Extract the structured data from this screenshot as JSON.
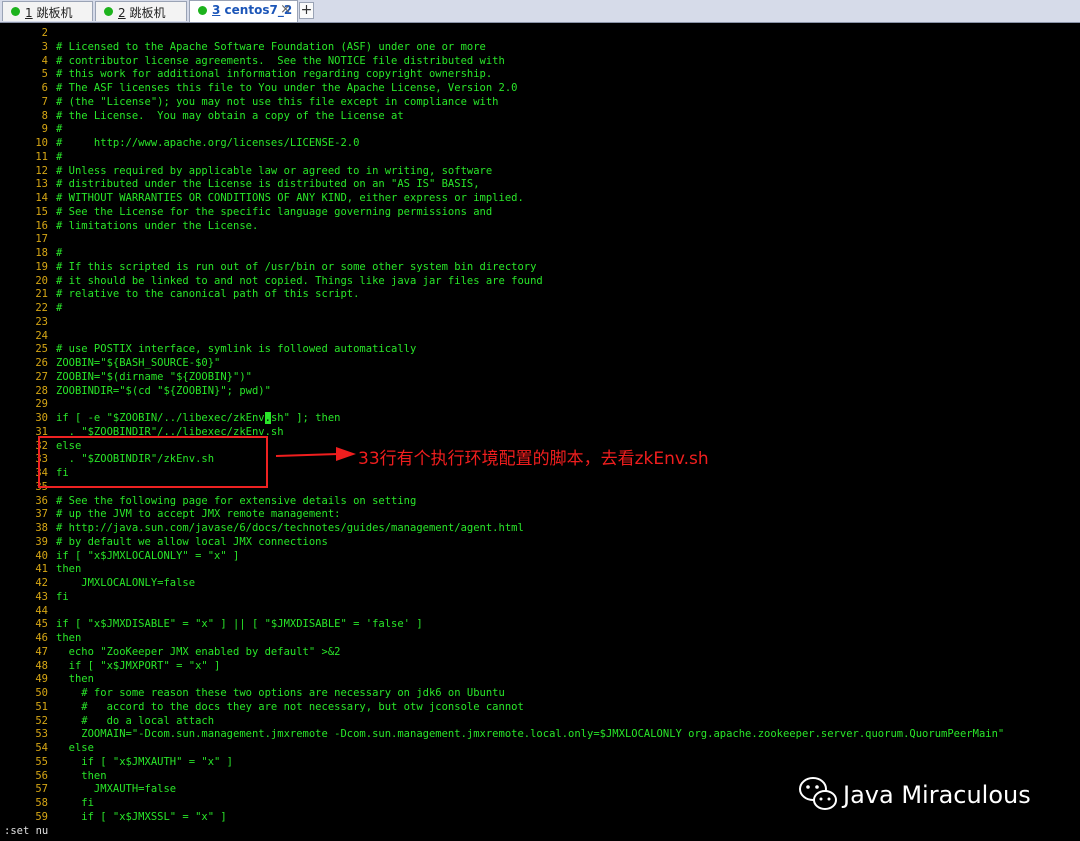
{
  "tabs": [
    {
      "number": "1",
      "label": "跳板机",
      "active": false
    },
    {
      "number": "2",
      "label": "跳板机",
      "active": false
    },
    {
      "number": "3",
      "label": "centos7_2",
      "active": true
    }
  ],
  "new_tab_label": "+",
  "close_glyph": "×",
  "colors": {
    "code": "#29e629",
    "line_number": "#d6a615",
    "annotation": "#f01e1e",
    "status_dot": "#1db31d"
  },
  "editor": {
    "lines": [
      {
        "n": "2",
        "text": ""
      },
      {
        "n": "3",
        "text": "# Licensed to the Apache Software Foundation (ASF) under one or more"
      },
      {
        "n": "4",
        "text": "# contributor license agreements.  See the NOTICE file distributed with"
      },
      {
        "n": "5",
        "text": "# this work for additional information regarding copyright ownership."
      },
      {
        "n": "6",
        "text": "# The ASF licenses this file to You under the Apache License, Version 2.0"
      },
      {
        "n": "7",
        "text": "# (the \"License\"); you may not use this file except in compliance with"
      },
      {
        "n": "8",
        "text": "# the License.  You may obtain a copy of the License at"
      },
      {
        "n": "9",
        "text": "#"
      },
      {
        "n": "10",
        "text": "#     http://www.apache.org/licenses/LICENSE-2.0"
      },
      {
        "n": "11",
        "text": "#"
      },
      {
        "n": "12",
        "text": "# Unless required by applicable law or agreed to in writing, software"
      },
      {
        "n": "13",
        "text": "# distributed under the License is distributed on an \"AS IS\" BASIS,"
      },
      {
        "n": "14",
        "text": "# WITHOUT WARRANTIES OR CONDITIONS OF ANY KIND, either express or implied."
      },
      {
        "n": "15",
        "text": "# See the License for the specific language governing permissions and"
      },
      {
        "n": "16",
        "text": "# limitations under the License."
      },
      {
        "n": "17",
        "text": ""
      },
      {
        "n": "18",
        "text": "#"
      },
      {
        "n": "19",
        "text": "# If this scripted is run out of /usr/bin or some other system bin directory"
      },
      {
        "n": "20",
        "text": "# it should be linked to and not copied. Things like java jar files are found"
      },
      {
        "n": "21",
        "text": "# relative to the canonical path of this script."
      },
      {
        "n": "22",
        "text": "#"
      },
      {
        "n": "23",
        "text": ""
      },
      {
        "n": "24",
        "text": ""
      },
      {
        "n": "25",
        "text": "# use POSTIX interface, symlink is followed automatically"
      },
      {
        "n": "26",
        "text": "ZOOBIN=\"${BASH_SOURCE-$0}\""
      },
      {
        "n": "27",
        "text": "ZOOBIN=\"$(dirname \"${ZOOBIN}\")\""
      },
      {
        "n": "28",
        "text": "ZOOBINDIR=\"$(cd \"${ZOOBIN}\"; pwd)\""
      },
      {
        "n": "29",
        "text": ""
      },
      {
        "n": "30",
        "text": "if [ -e \"$ZOOBIN/../libexec/zkEnv.sh\" ]; then"
      },
      {
        "n": "31",
        "text": "  . \"$ZOOBINDIR\"/../libexec/zkEnv.sh"
      },
      {
        "n": "32",
        "text": "else"
      },
      {
        "n": "33",
        "text": "  . \"$ZOOBINDIR\"/zkEnv.sh"
      },
      {
        "n": "34",
        "text": "fi"
      },
      {
        "n": "35",
        "text": ""
      },
      {
        "n": "36",
        "text": "# See the following page for extensive details on setting"
      },
      {
        "n": "37",
        "text": "# up the JVM to accept JMX remote management:"
      },
      {
        "n": "38",
        "text": "# http://java.sun.com/javase/6/docs/technotes/guides/management/agent.html"
      },
      {
        "n": "39",
        "text": "# by default we allow local JMX connections"
      },
      {
        "n": "40",
        "text": "if [ \"x$JMXLOCALONLY\" = \"x\" ]"
      },
      {
        "n": "41",
        "text": "then"
      },
      {
        "n": "42",
        "text": "    JMXLOCALONLY=false"
      },
      {
        "n": "43",
        "text": "fi"
      },
      {
        "n": "44",
        "text": ""
      },
      {
        "n": "45",
        "text": "if [ \"x$JMXDISABLE\" = \"x\" ] || [ \"$JMXDISABLE\" = 'false' ]"
      },
      {
        "n": "46",
        "text": "then"
      },
      {
        "n": "47",
        "text": "  echo \"ZooKeeper JMX enabled by default\" >&2"
      },
      {
        "n": "48",
        "text": "  if [ \"x$JMXPORT\" = \"x\" ]"
      },
      {
        "n": "49",
        "text": "  then"
      },
      {
        "n": "50",
        "text": "    # for some reason these two options are necessary on jdk6 on Ubuntu"
      },
      {
        "n": "51",
        "text": "    #   accord to the docs they are not necessary, but otw jconsole cannot"
      },
      {
        "n": "52",
        "text": "    #   do a local attach"
      },
      {
        "n": "53",
        "text": "    ZOOMAIN=\"-Dcom.sun.management.jmxremote -Dcom.sun.management.jmxremote.local.only=$JMXLOCALONLY org.apache.zookeeper.server.quorum.QuorumPeerMain\""
      },
      {
        "n": "54",
        "text": "  else"
      },
      {
        "n": "55",
        "text": "    if [ \"x$JMXAUTH\" = \"x\" ]"
      },
      {
        "n": "56",
        "text": "    then"
      },
      {
        "n": "57",
        "text": "      JMXAUTH=false"
      },
      {
        "n": "58",
        "text": "    fi"
      },
      {
        "n": "59",
        "text": "    if [ \"x$JMXSSL\" = \"x\" ]"
      }
    ],
    "cursor": {
      "line": "30",
      "column": 33
    }
  },
  "status_line": ":set nu",
  "annotation": "33行有个执行环境配置的脚本，去看zkEnv.sh",
  "watermark": {
    "icon": "wechat-icon",
    "text": "Java Miraculous"
  }
}
